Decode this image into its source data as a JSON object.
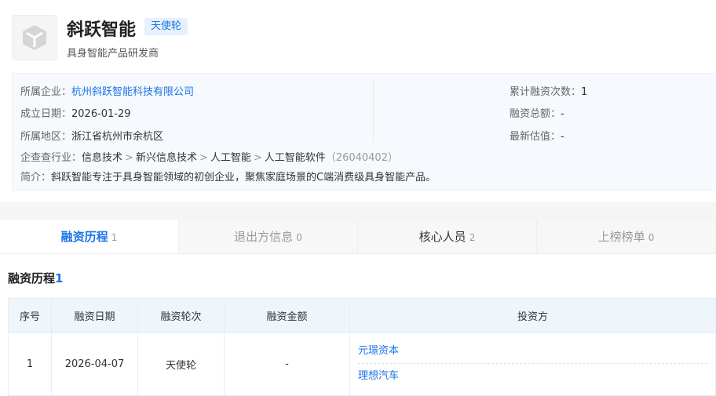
{
  "company": {
    "name": "斜跃智能",
    "round_badge": "天使轮",
    "tagline": "具身智能产品研发商"
  },
  "info": {
    "entity_label": "所属企业：",
    "entity_value": "杭州斜跃智能科技有限公司",
    "founded_label": "成立日期：",
    "founded_value": "2026-01-29",
    "region_label": "所属地区：",
    "region_value": "浙江省杭州市余杭区",
    "industry_label": "企查查行业：",
    "industry_path": [
      "信息技术",
      "新兴信息技术",
      "人工智能",
      "人工智能软件"
    ],
    "industry_sep": ">",
    "industry_code": "（26040402）",
    "intro_label": "简介：",
    "intro_value": "斜跃智能专注于具身智能领域的初创企业，聚焦家庭场景的C端消费级具身智能产品。",
    "rounds_label": "累计融资次数：",
    "rounds_value": "1",
    "total_label": "融资总额：",
    "total_value": "-",
    "valuation_label": "最新估值：",
    "valuation_value": "-"
  },
  "tabs": [
    {
      "label": "融资历程",
      "count": "1"
    },
    {
      "label": "退出方信息",
      "count": "0"
    },
    {
      "label": "核心人员",
      "count": "2"
    },
    {
      "label": "上榜榜单",
      "count": "0"
    }
  ],
  "section": {
    "title": "融资历程",
    "count": "1"
  },
  "table": {
    "headers": [
      "序号",
      "融资日期",
      "融资轮次",
      "融资金额",
      "投资方"
    ],
    "rows": [
      {
        "index": "1",
        "date": "2026-04-07",
        "round": "天使轮",
        "amount": "-",
        "investors": [
          "元璟资本",
          "理想汽车"
        ]
      }
    ]
  }
}
